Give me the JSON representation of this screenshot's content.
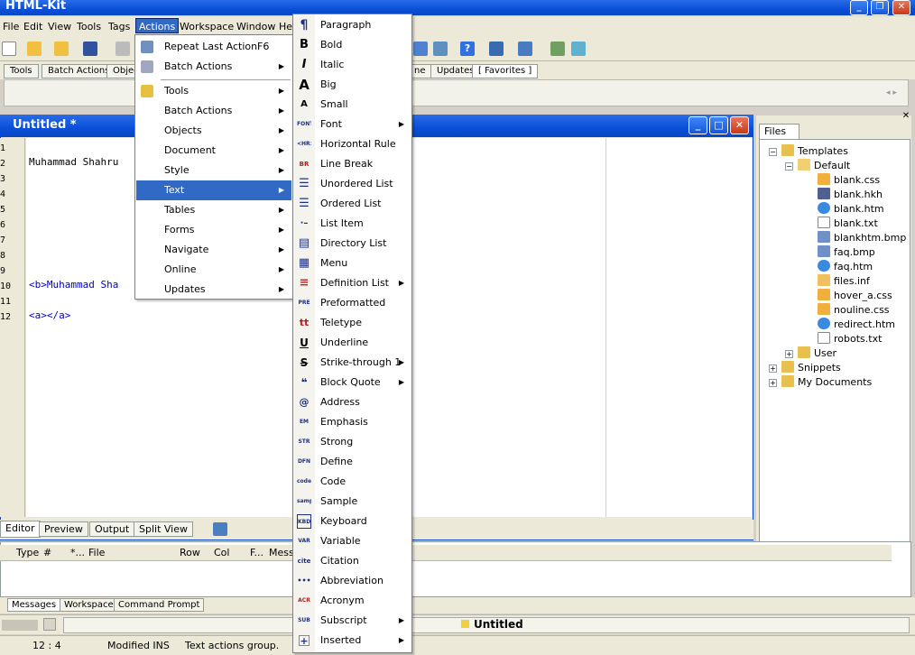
{
  "app": {
    "title": "HTML-Kit"
  },
  "menubar": [
    {
      "label": "File"
    },
    {
      "label": "Edit"
    },
    {
      "label": "View"
    },
    {
      "label": "Tools"
    },
    {
      "label": "Tags"
    },
    {
      "label": "Actions"
    },
    {
      "label": "Workspace"
    },
    {
      "label": "Window"
    },
    {
      "label": "He"
    }
  ],
  "toolbar_tabs": [
    {
      "label": "Tools"
    },
    {
      "label": "Batch Actions"
    },
    {
      "label": "Objec"
    },
    {
      "label": "ne"
    },
    {
      "label": "Updates"
    },
    {
      "label": "[ Favorites ]"
    }
  ],
  "editor": {
    "title": "Untitled *",
    "line_numbers": [
      "1",
      "2",
      "3",
      "4",
      "5",
      "6",
      "7",
      "8",
      "9",
      "10",
      "11",
      "12"
    ],
    "lines": [
      "Muhammad Shahru",
      "<b>Muhammad Sha",
      "<a></a>"
    ],
    "tabs": [
      {
        "label": "Editor"
      },
      {
        "label": "Preview"
      },
      {
        "label": "Output"
      },
      {
        "label": "Split View"
      }
    ]
  },
  "actions_menu": [
    {
      "label": "Repeat Last Action",
      "shortcut": "F6"
    },
    {
      "label": "Batch Actions"
    },
    {
      "label": "Tools"
    },
    {
      "label": "Batch Actions"
    },
    {
      "label": "Objects"
    },
    {
      "label": "Document"
    },
    {
      "label": "Style"
    },
    {
      "label": "Text"
    },
    {
      "label": "Tables"
    },
    {
      "label": "Forms"
    },
    {
      "label": "Navigate"
    },
    {
      "label": "Online"
    },
    {
      "label": "Updates"
    }
  ],
  "text_menu": [
    {
      "label": "Paragraph",
      "glyph": "¶"
    },
    {
      "label": "Bold",
      "glyph": "B"
    },
    {
      "label": "Italic",
      "glyph": "I"
    },
    {
      "label": "Big",
      "glyph": "A"
    },
    {
      "label": "Small",
      "glyph": "A"
    },
    {
      "label": "Font",
      "glyph": "FONT"
    },
    {
      "label": "Horizontal Rule",
      "glyph": "<HR>"
    },
    {
      "label": "Line Break",
      "glyph": "BR"
    },
    {
      "label": "Unordered List",
      "glyph": "☰"
    },
    {
      "label": "Ordered List",
      "glyph": "☰"
    },
    {
      "label": "List Item",
      "glyph": "·–"
    },
    {
      "label": "Directory List",
      "glyph": "▤"
    },
    {
      "label": "Menu",
      "glyph": "▦"
    },
    {
      "label": "Definition List",
      "glyph": "≡"
    },
    {
      "label": "Preformatted",
      "glyph": "PRE"
    },
    {
      "label": "Teletype",
      "glyph": "tt"
    },
    {
      "label": "Underline",
      "glyph": "U"
    },
    {
      "label": "Strike-through 1",
      "glyph": "S"
    },
    {
      "label": "Block Quote",
      "glyph": "❝"
    },
    {
      "label": "Address",
      "glyph": "@"
    },
    {
      "label": "Emphasis",
      "glyph": "EM"
    },
    {
      "label": "Strong",
      "glyph": "STR"
    },
    {
      "label": "Define",
      "glyph": "DFN"
    },
    {
      "label": "Code",
      "glyph": "code"
    },
    {
      "label": "Sample",
      "glyph": "samp"
    },
    {
      "label": "Keyboard",
      "glyph": "KBD"
    },
    {
      "label": "Variable",
      "glyph": "VAR"
    },
    {
      "label": "Citation",
      "glyph": "cite"
    },
    {
      "label": "Abbreviation",
      "glyph": "•••"
    },
    {
      "label": "Acronym",
      "glyph": "ACR"
    },
    {
      "label": "Subscript",
      "glyph": "SUB"
    },
    {
      "label": "Inserted",
      "glyph": "+"
    }
  ],
  "files_panel": {
    "tab": "Files",
    "tree": [
      {
        "label": "Templates",
        "icon": "folder"
      },
      {
        "label": "Default",
        "icon": "folder-open"
      },
      {
        "label": "blank.css",
        "icon": "css-file"
      },
      {
        "label": "blank.hkh",
        "icon": "hkh-file"
      },
      {
        "label": "blank.htm",
        "icon": "ie-file"
      },
      {
        "label": "blank.txt",
        "icon": "text-file"
      },
      {
        "label": "blankhtm.bmp",
        "icon": "bmp-file"
      },
      {
        "label": "faq.bmp",
        "icon": "bmp-file"
      },
      {
        "label": "faq.htm",
        "icon": "ie-file"
      },
      {
        "label": "files.inf",
        "icon": "inf-file"
      },
      {
        "label": "hover_a.css",
        "icon": "css-file"
      },
      {
        "label": "nouline.css",
        "icon": "css-file"
      },
      {
        "label": "redirect.htm",
        "icon": "ie-file"
      },
      {
        "label": "robots.txt",
        "icon": "text-file"
      },
      {
        "label": "User",
        "icon": "folder"
      },
      {
        "label": "Snippets",
        "icon": "folder"
      },
      {
        "label": "My Documents",
        "icon": "folder"
      }
    ]
  },
  "messages": {
    "columns": [
      {
        "label": "Type"
      },
      {
        "label": "#"
      },
      {
        "label": "*..."
      },
      {
        "label": "File"
      },
      {
        "label": "Row"
      },
      {
        "label": "Col"
      },
      {
        "label": "F..."
      },
      {
        "label": "Mess"
      }
    ],
    "tabs": [
      {
        "label": "Messages"
      },
      {
        "label": "Workspace"
      },
      {
        "label": "Command Prompt"
      }
    ]
  },
  "document_tab": "Untitled",
  "status": {
    "position": "12 : 4",
    "mode": "Modified INS",
    "message": "Text actions group."
  },
  "colors": {
    "accent": "#316ac5",
    "titlebar": "#0a4fd8",
    "menubar": "#ece9d8"
  }
}
